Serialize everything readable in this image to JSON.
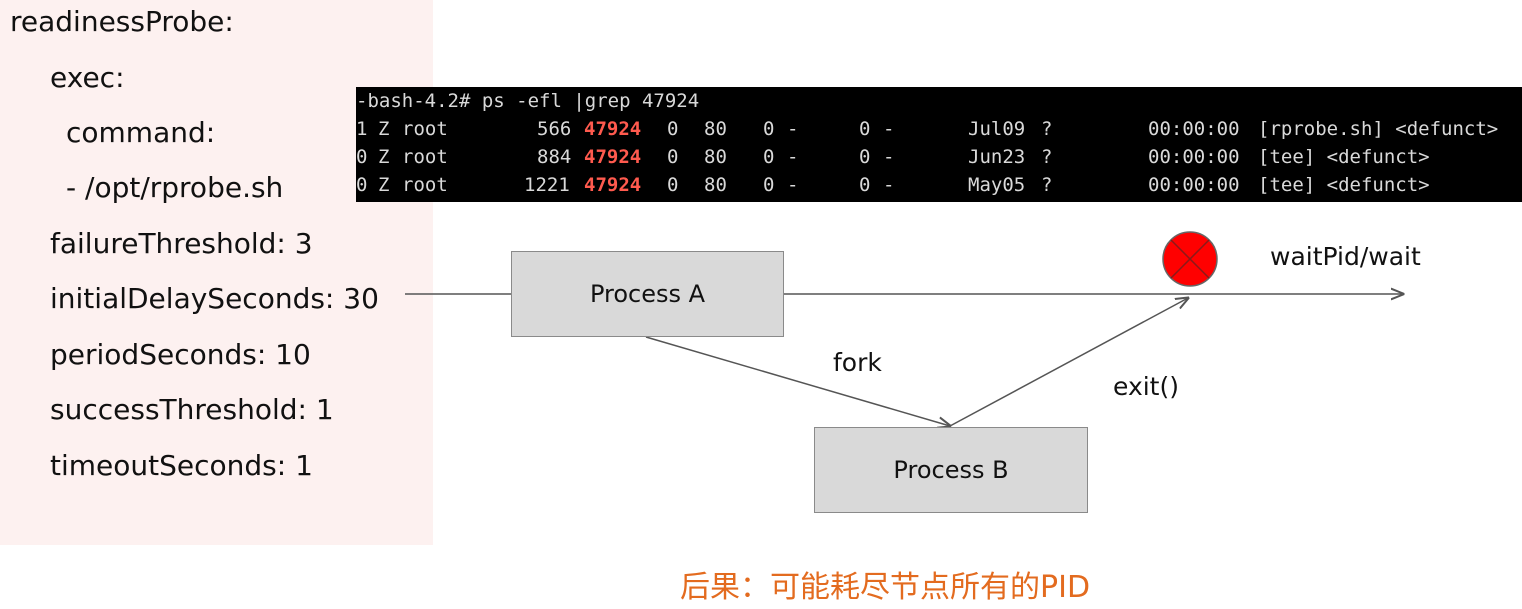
{
  "yaml": {
    "lines": [
      "readinessProbe:",
      "exec:",
      "command:",
      "- /opt/rprobe.sh",
      "failureThreshold: 3",
      "initialDelaySeconds: 30",
      "periodSeconds: 10",
      "successThreshold: 1",
      "timeoutSeconds: 1"
    ]
  },
  "terminal": {
    "prompt": "-bash-4.2# ps -efl |grep 47924",
    "rows": [
      {
        "f": "1",
        "s": "Z",
        "user": "root",
        "pid": "566",
        "ppid": "47924",
        "c": "0",
        "pri": "80",
        "ni": "0",
        "addr": "-",
        "sz": "0",
        "wchan": "-",
        "stime": "Jul09",
        "tty": "?",
        "time": "00:00:00",
        "cmd": "[rprobe.sh] <defunct>"
      },
      {
        "f": "0",
        "s": "Z",
        "user": "root",
        "pid": "884",
        "ppid": "47924",
        "c": "0",
        "pri": "80",
        "ni": "0",
        "addr": "-",
        "sz": "0",
        "wchan": "-",
        "stime": "Jun23",
        "tty": "?",
        "time": "00:00:00",
        "cmd": "[tee] <defunct>"
      },
      {
        "f": "0",
        "s": "Z",
        "user": "root",
        "pid": "1221",
        "ppid": "47924",
        "c": "0",
        "pri": "80",
        "ni": "0",
        "addr": "-",
        "sz": "0",
        "wchan": "-",
        "stime": "May05",
        "tty": "?",
        "time": "00:00:00",
        "cmd": "[tee] <defunct>"
      }
    ],
    "highlight_color": "#ff5a4e"
  },
  "diagram": {
    "process_a": "Process A",
    "process_b": "Process B",
    "fork_label": "fork",
    "exit_label": "exit()",
    "wait_label": "waitPid/wait",
    "error_marker_color": "#ff0000"
  },
  "footer": {
    "text": "后果：可能耗尽节点所有的PID",
    "color": "#e36b1f"
  }
}
